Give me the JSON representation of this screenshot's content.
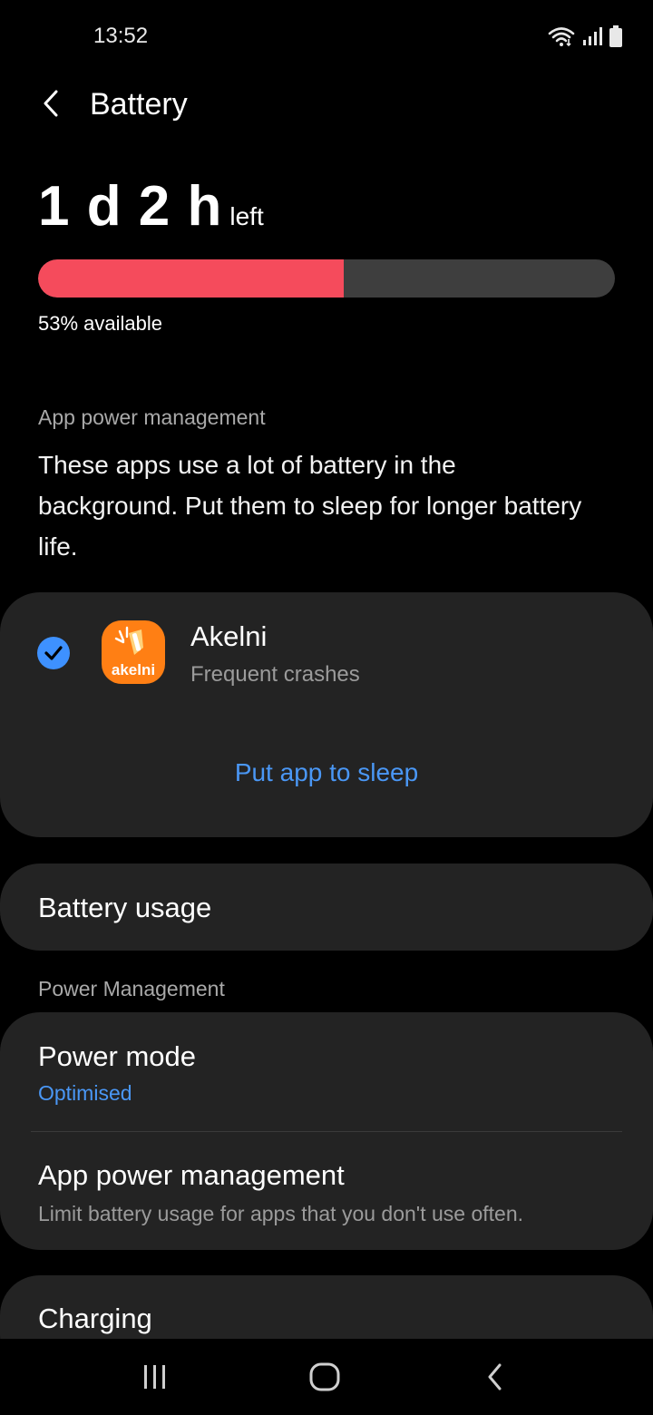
{
  "status_bar": {
    "time": "13:52",
    "icons": [
      "wifi-icon",
      "signal-icon",
      "battery-status-icon"
    ]
  },
  "header": {
    "back_icon": "back-arrow-icon",
    "title": "Battery"
  },
  "battery": {
    "time_value": "1 d 2 h",
    "time_suffix": "left",
    "level_percent": 53,
    "available_text": "53% available",
    "fill_color": "#f54b5c",
    "track_color": "#3e3e3e"
  },
  "app_power_section": {
    "label": "App power management",
    "description": "These apps use a lot of battery in the background. Put them to sleep for longer battery life."
  },
  "app_card": {
    "app_name": "Akelni",
    "app_subtitle": "Frequent crashes",
    "app_icon_text": "akelni",
    "checked": true,
    "action_label": "Put app to sleep",
    "accent_color": "#4a97f5"
  },
  "battery_usage": {
    "label": "Battery usage"
  },
  "power_management": {
    "section_label": "Power Management",
    "items": [
      {
        "title": "Power mode",
        "subtitle": "Optimised"
      },
      {
        "title": "App power management",
        "subtitle": "Limit battery usage for apps that you don't use often."
      }
    ]
  },
  "charging": {
    "label": "Charging"
  },
  "nav_bar": {
    "buttons": [
      "recent-apps-icon",
      "home-icon",
      "back-icon"
    ]
  }
}
